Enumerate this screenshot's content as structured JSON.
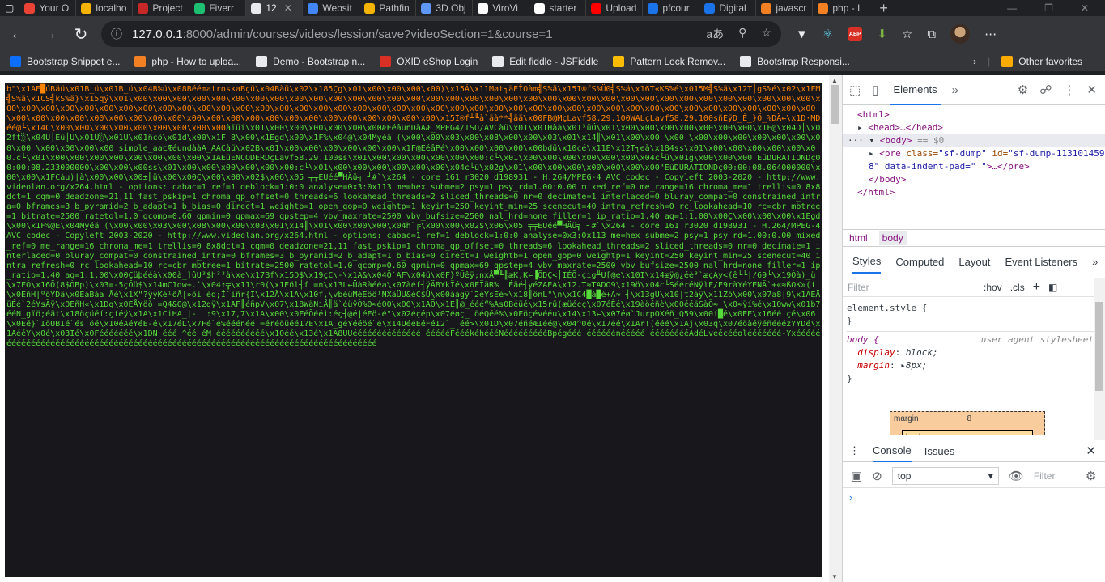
{
  "tabs": [
    {
      "title": "",
      "color": "#ffffff"
    },
    {
      "title": "Your O",
      "color": "#ea4335"
    },
    {
      "title": "localho",
      "color": "#f4b400"
    },
    {
      "title": "Project",
      "color": "#c62828"
    },
    {
      "title": "Fiverr",
      "color": "#1dbf73"
    },
    {
      "title": "12",
      "color": "#e8eaed",
      "active": true
    },
    {
      "title": "Websit",
      "color": "#4285f4"
    },
    {
      "title": "Pathfin",
      "color": "#f4b400"
    },
    {
      "title": "3D Obj",
      "color": "#5e97f6"
    },
    {
      "title": "ViroVi",
      "color": "#ffffff"
    },
    {
      "title": "starter",
      "color": "#ffffff"
    },
    {
      "title": "Upload",
      "color": "#ff0000"
    },
    {
      "title": "pfcour",
      "color": "#1a73e8"
    },
    {
      "title": "Digital",
      "color": "#1a73e8"
    },
    {
      "title": "javascr",
      "color": "#f48024"
    },
    {
      "title": "php - I",
      "color": "#f48024"
    }
  ],
  "address": {
    "host": "127.0.0.1",
    "rest": ":8000/admin/courses/videos/lession/save?videoSection=1&course=1"
  },
  "bookmarks": [
    {
      "label": "Bootstrap Snippet e...",
      "color": "#0d6efd"
    },
    {
      "label": "php - How to uploa...",
      "color": "#f48024"
    },
    {
      "label": "Demo - Bootstrap n...",
      "color": "#e8eaed"
    },
    {
      "label": "OXID eShop Login",
      "color": "#d93025"
    },
    {
      "label": "Edit fiddle - JSFiddle",
      "color": "#e8eaed"
    },
    {
      "label": "Pattern Lock Remov...",
      "color": "#fbbc04"
    },
    {
      "label": "Bootstrap Responsi...",
      "color": "#e8eaed"
    }
  ],
  "other_favorites": "Other favorites",
  "dump": {
    "red_text": "b\"\\x1AE█úBäü\\x01B_ü\\x01B_ü\\x04B%ü\\x08BéématroskaBçü\\x04Bàü\\x02\\x185Çg\\x01\\x00\\x00\\x00\\x00)\\x15Á\\x11Møt┐äEÎOàm╣S%ä\\x15I®fS%Ü0╣S%ä\\x16T«KS%é\\x015M╣S%ä\\x12T│gS%é\\x02\\x1FM╣S%ä\\x1CS╣kS%ä}\\x15qý\\x01\\x00\\x00\\x00\\x00\\x00\\x00\\x00\\x00\\x00\\x00\\x00\\x00\\x00\\x00\\x00\\x00\\x00\\x00\\x00\\x00\\x00\\x00\\x00\\x00\\x00\\x00\\x00\\x00\\x00\\x00\\x00\\x00\\x00\\x00\\x00\\x00\\x00\\x00\\x00\\x00\\x00\\x00\\x00\\x00\\x00\\x00\\x00\\x00\\x00\\x00\\x00\\x00\\x00\\x00\\x00\\x00\\x00\\x00\\x00\\x00\\x00\\x00\\x00\\x00\\x00\\x00\\x00\\x00\\x00\\x00\\x00\\x00\\x00\\x00\\x00\\x00\\x00\\x00\\x00\\x00\\x00\\x00\\x00\\x00\\x00\\x00\\x00\\x00\\x00\\x00\\x00\\x00\\x00\\x00\\x00\\x00\\x00\\x00\\x00\\x15I®f┴╙à`äà**╣ää\\x00FB@MçLavf58.29.100WALçLavf58.29.100sñEÿD_È_}Ö_%DÄ←\\x1D·MDéé@└\\x14C\\x00\\x00\\x00\\x00\\x00\\x00\\x00\\x00\\x00",
    "green_text": "àïüi\\x01\\x00\\x00\\x00\\x00\\x00\\x00ÆEéâunDàAÆ_MPEG4/ISO/AVCàü\\x01\\x01Hàà\\x01³üÖ\\x01\\x00\\x00\\x00\\x00\\x00\\x00\\x00\\x1F@\\x04D│\\x02ft░\\x04U│Eü│U\\x01U░\\x01U\\x01ñcö\\x01d\\x00\\x1F 8\\x00\\x1Egd\\x00\\x1F%\\x04@\\x04Myéä (\\x00\\x00\\x03\\x00\\x08\\x00\\x00\\x03\\x01\\x14║\\x01\\x00\\x00 \\x00 \\x00\\x00\\x00\\x00\\x00\\x00\\x00\\x00 \\x00\\x00\\x00\\x00 simple_aacÆéundààA_AACàü\\x02B\\x01\\x00\\x00\\x00\\x00\\x00\\x00\\x1F@EéâPé\\x00\\x00\\x00\\x00\\x00bdü\\x10cé\\x11E\\x12T┐eà\\x184ss\\x01\\x00\\x00\\x00\\x00\\x00\\x00.c└\\x01\\x00\\x00\\x00\\x00\\x00\\x00\\x00\\x00\\x1AEüENCODERDçLavf58.29.100ss\\x01\\x00\\x00\\x00\\x00\\x00\\x00:c└\\x01\\x00\\x00\\x00\\x00\\x00\\x00\\x04c└ü\\x01g\\x00\\x00\\x00 EüDURATIONDç00:00:08.233000000\\x00\\x00\\x00ss\\x01\\x00\\x00\\x00\\x00\\x00\\x00:c└\\x01\\x00\\x00\\x00\\x00\\x00\\x00\\x04c└ü\\x02g\\x01\\x00\\x00\\x00\\x00\\x00\\x00\\x00\"EüDURATIONDç00:00:08.064000000\\x00\\x00\\x1FCàu)|à\\x00\\x00\\x00±║ü\\x00\\x00Ç\\x00\\x00\\x02$\\x06\\x05 ╤╤EUéé▀HÄü╗ ┘#`\\x264 - core 161 r3020 d198931 - H.264/MPEG-4 AVC codec - Copyleft 2003-2020 - http://www.videolan.org/x264.html - options: cabac=1 ref=1 deblock=1:0:0 analyse=0x3:0x113 me=hex subme=2 psy=1 psy_rd=1.00:0.00 mixed_ref=0 me_range=16 chroma_me=1 trellis=0 8x8dct=1 cqm=0 deadzone=21,11 fast_pskip=1 chroma_qp_offset=0 threads=6 lookahead_threads=2 sliced_threads=0 nr=0 decimate=1 interlaced=0 bluray_compat=0 constrained_intra=0 bframes=3 b_pyramid=2 b_adapt=1 b_bias=0 direct=1 weightb=1 open_gop=0 weightp=1 keyint=250 keyint_min=25 scenecut=40 intra_refresh=0 rc_lookahead=10 rc=cbr mbtree=1 bitrate=2500 ratetol=1.0 qcomp=0.60 qpmin=0 qpmax=69 qpstep=4 vbv_maxrate=2500 vbv_bufsize=2500 nal_hrd=none filler=1 ip_ratio=1.40 aq=1:1.00\\x00Ç\\x00\\x00\\x00\\x1Egd\\x00\\x1F%@E\\x04Myéä (\\x00\\x00\\x03\\x00\\x08\\x00\\x00\\x03\\x01\\x14║\\x01\\x00\\x00\\x00\\x04h`╔\\x00\\x00\\x02$\\x06\\x05 ╤╤EUéé▀HÄü╗ ┘#`\\x264 - core 161 r3020 d198931 - H.264/MPEG-4 AVC codec - Copyleft 2003-2020 - http://www.videolan.org/x264.html - options: cabac=1 ref=1 deblock=1:0:0 analyse=0x3:0x113 me=hex subme=2 psy=1 psy_rd=1.00:0.00 mixed_ref=0 me_range=16 chroma_me=1 trellis=0 8x8dct=1 cqm=0 deadzone=21,11 fast_pskip=1 chroma_qp_offset=0 threads=6 lookahead_threads=2 sliced_threads=0 nr=0 decimate=1 interlaced=0 bluray_compat=0 constrained_intra=0 bframes=3 b_pyramid=2 b_adapt=1 b_bias=0 direct=1 weightb=1 open_gop=0 weightp=1 keyint=250 keyint_min=25 scenecut=40 intra_refresh=0 rc_lookahead=10 rc=cbr mbtree=1 bitrate=2500 ratetol=1.0 qcomp=0.60 qpmin=0 qpmax=69 qpstep=4 vbv_maxrate=2500 vbv_bufsize=2500 nal_hrd=none filler=1 ip_ratio=1.40 aq=1:1.00\\x00Çüþééà\\x00à_]ûU³$h³³à\\xe\\x17Bf\\x15D$\\x19çC\\-\\x1A&\\x04Õ`AF\\x04ü\\x0F}ºÜêÿ;nxÅ▀╙║æK,K←▐ÕDÇ<│IÉÕ-çig╨U[@e\\x10I\\x14æÿ@¿éè³`æçAy<{ê└└|/69└\\x19Òà)_ü\\x7FÒ\\x16Õ(8$ÒBp)\\x03=-5çÕü$\\x14mC1dw+.`\\x04↑╦\\x11\\r0(\\x1Eñl┤f =n\\x13L←ÜàRàééa\\x07àéf┤ÿÄBYkÏé\\x0FÏäR%  Éäé┤yéZAEA\\x12.T≈TADO9\\x19ö\\x04c└SééréNÿìF/E9ràYéYENÄ`+«≈ßOK»(í\\x0EñH|ºöYDä\\x0EàBàa Åé\\x1X\"?ÿýKé¹õÅ|»öi_éd;Í`iñr{I\\x12Ä\\x1A\\x10f,\\vbéüMéEöö¹NXäÜU&éC$Ù\\x00ààgÿ`2éYsEé≈\\x18║ônL\"\\n\\x1C4█à█é+A≈`┤\\x13gU\\x10|t2àÿ\\x11Zó\\x00\\x07a",
    "green_text2": "8|9\\x1AEÄüÉé`2éYsÄÿ\\x0EñH«\\x1Dg\\x0EÅYöò =Q4&0@\\x12gÿ\\x1AF║éñpV\\x07\\x18WäNiÅ║ä`éüÿÒ%0≈é0O\\x00\\x1AÕ\\x1E║@_ééé“%As0Béüé\\x15rü(æüécç\\x07éÊé\\x19àöéñè\\x00ééäSàÖ≈ \\x0≈ÿí%é\\x10ww\\x01b7ééN_gïö;éät\\x18öçüéí:çíéÿ\\x1A\\x1CiHA_|-  :9\\x17,7\\x1A\\x00\\x0FéÕééi:éç┤@é|éEö-é\"\\x02éçép\\x07éøç_ öéQéé%\\x0Föçévééu\\x14\\x13←\\x07éø`JurpOXéñ_Q59\\x00í█é\\x0EE\\x16éé çé\\x06\\x0Eé}`IöUBIé`és öé\\x10éAéYéE-é\\x17éL\\x7Fé`é%ééénéé =éréöüéé1?E\\x1A_géYééöé`é\\x14UééEéFéI2`_ éé>\\x01D\\x07éñéÆIéé@\\x04^0é\\x17éé\\x1Ar!(ééé\\x1Aj\\x03q\\x07éöàéÿéñééézYYDé\\x1AééY\\x0é\\x03Ié\\x0Fééééééé\\x1DN_ééé_^éé éM_éééééééééé\\x10éé\\x13é\\x1A8UUéééééééééééééé_éééééFééékéhéééNéééééééééBpégééé éééééénééééé_ééééééééAdéLveécééolééééééé-Yxééééééééééééééééééééééééééééééééééééééééééééééééééééééééééééééééééééééééééééééééé"
  },
  "devtools": {
    "tabs": [
      "Elements"
    ],
    "html_open": "<html>",
    "head": "<head>…</head>",
    "body_open": "<body>",
    "body_marker": "== $0",
    "pre_tag": "<pre",
    "pre_class_attr": "class=",
    "pre_class_val": "\"sf-dump\"",
    "pre_id_attr": "id=",
    "pre_id_val": "\"sf-dump-113101459",
    "pre_indent_attr": "8\" data-indent-pad=",
    "pre_indent_val": "\"  \"",
    "pre_close": ">…</pre>",
    "body_close": "</body>",
    "html_close": "</html>",
    "crumbs": [
      "html",
      "body"
    ],
    "style_tabs": [
      "Styles",
      "Computed",
      "Layout",
      "Event Listeners"
    ],
    "filter_placeholder": "Filter",
    "hov": ":hov",
    "cls": ".cls",
    "element_style": "element.style {",
    "close_brace": "}",
    "body_selector": "body {",
    "ua": "user agent stylesheet",
    "rule1_prop": "display",
    "rule1_val": "block;",
    "rule2_prop": "margin",
    "rule2_val": "8px;",
    "margin_label": "margin",
    "margin_val": "8",
    "border_label": "border",
    "console_tabs": [
      "Console",
      "Issues"
    ],
    "context": "top",
    "console_filter": "Filter"
  }
}
